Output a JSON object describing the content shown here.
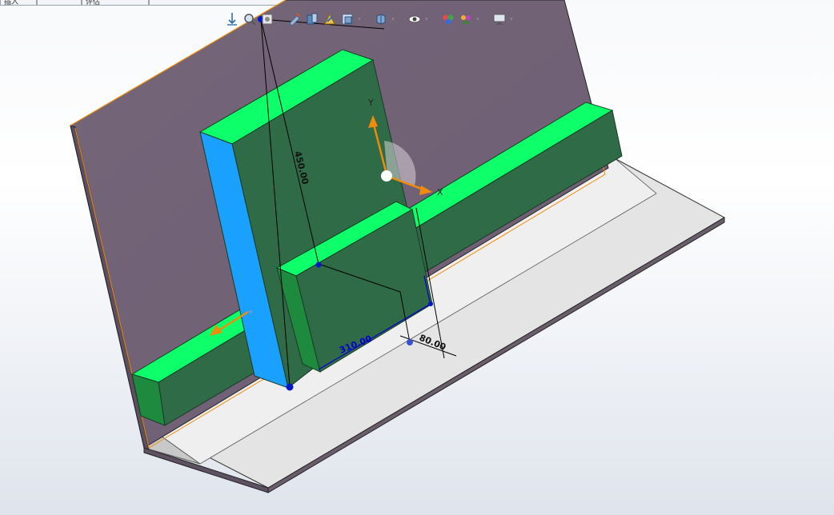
{
  "tabs": [
    {
      "label": "插入"
    },
    {
      "label": ""
    },
    {
      "label": "评估"
    },
    {
      "label": ""
    }
  ],
  "toolbar": {
    "items": [
      {
        "icon": "zoom-to-fit-icon"
      },
      {
        "icon": "zoom-to-area-icon"
      },
      {
        "icon": "previous-view-icon"
      },
      {
        "icon": "section-view-icon"
      },
      {
        "icon": "dynamic-annotation-icon"
      },
      {
        "icon": "view-orientation-icon"
      },
      {
        "icon": "display-style-icon"
      },
      {
        "icon": "hide-show-items-icon"
      },
      {
        "icon": "edit-appearance-icon"
      },
      {
        "icon": "apply-scene-icon"
      },
      {
        "icon": "view-settings-icon"
      }
    ]
  },
  "dimensions": {
    "height": "450.00",
    "width": "310.00",
    "depth": "80.00"
  },
  "triad": {
    "x_label": "X",
    "y_label": "Y"
  },
  "colors": {
    "plate": "#756579",
    "block_top": "#0dff6a",
    "block_side": "#2e6b46",
    "selected_face": "#1aa0ff",
    "floor": "#e4e4e4",
    "dimension": "#000000",
    "selected_dimension": "#0000cc",
    "triad_arrow": "#f08c0a"
  }
}
